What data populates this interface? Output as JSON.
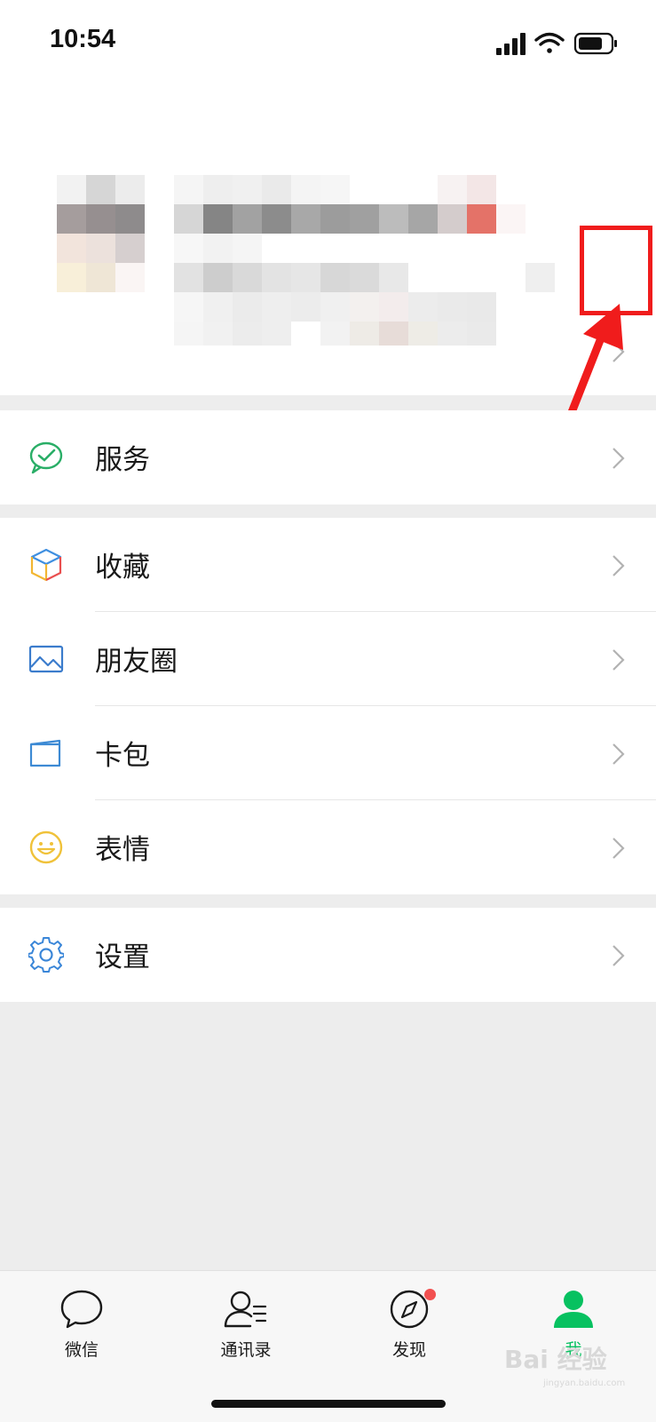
{
  "status_bar": {
    "time": "10:54",
    "icons": [
      "signal-icon",
      "wifi-icon",
      "battery-icon"
    ]
  },
  "profile": {
    "icons": [
      "avatar-blurred",
      "chevron-right-icon"
    ]
  },
  "menu": {
    "groups": [
      [
        {
          "label": "服务",
          "icon": "service-check-icon"
        }
      ],
      [
        {
          "label": "收藏",
          "icon": "favorites-cube-icon"
        },
        {
          "label": "朋友圈",
          "icon": "moments-image-icon"
        },
        {
          "label": "卡包",
          "icon": "card-wallet-icon"
        },
        {
          "label": "表情",
          "icon": "smiley-icon"
        }
      ],
      [
        {
          "label": "设置",
          "icon": "gear-icon"
        }
      ]
    ]
  },
  "tabbar": {
    "tabs": [
      {
        "label": "微信",
        "icon": "chat-bubble-icon",
        "active": false
      },
      {
        "label": "通讯录",
        "icon": "contacts-icon",
        "active": false
      },
      {
        "label": "发现",
        "icon": "compass-icon",
        "active": false,
        "badge": true
      },
      {
        "label": "我",
        "icon": "person-icon",
        "active": true
      }
    ]
  },
  "watermark": {
    "text": "Bai 经验",
    "sub": "jingyan.baidu.com"
  },
  "colors": {
    "accent": "#07c160",
    "annotation": "#f01c1c",
    "badge": "#f25050"
  }
}
